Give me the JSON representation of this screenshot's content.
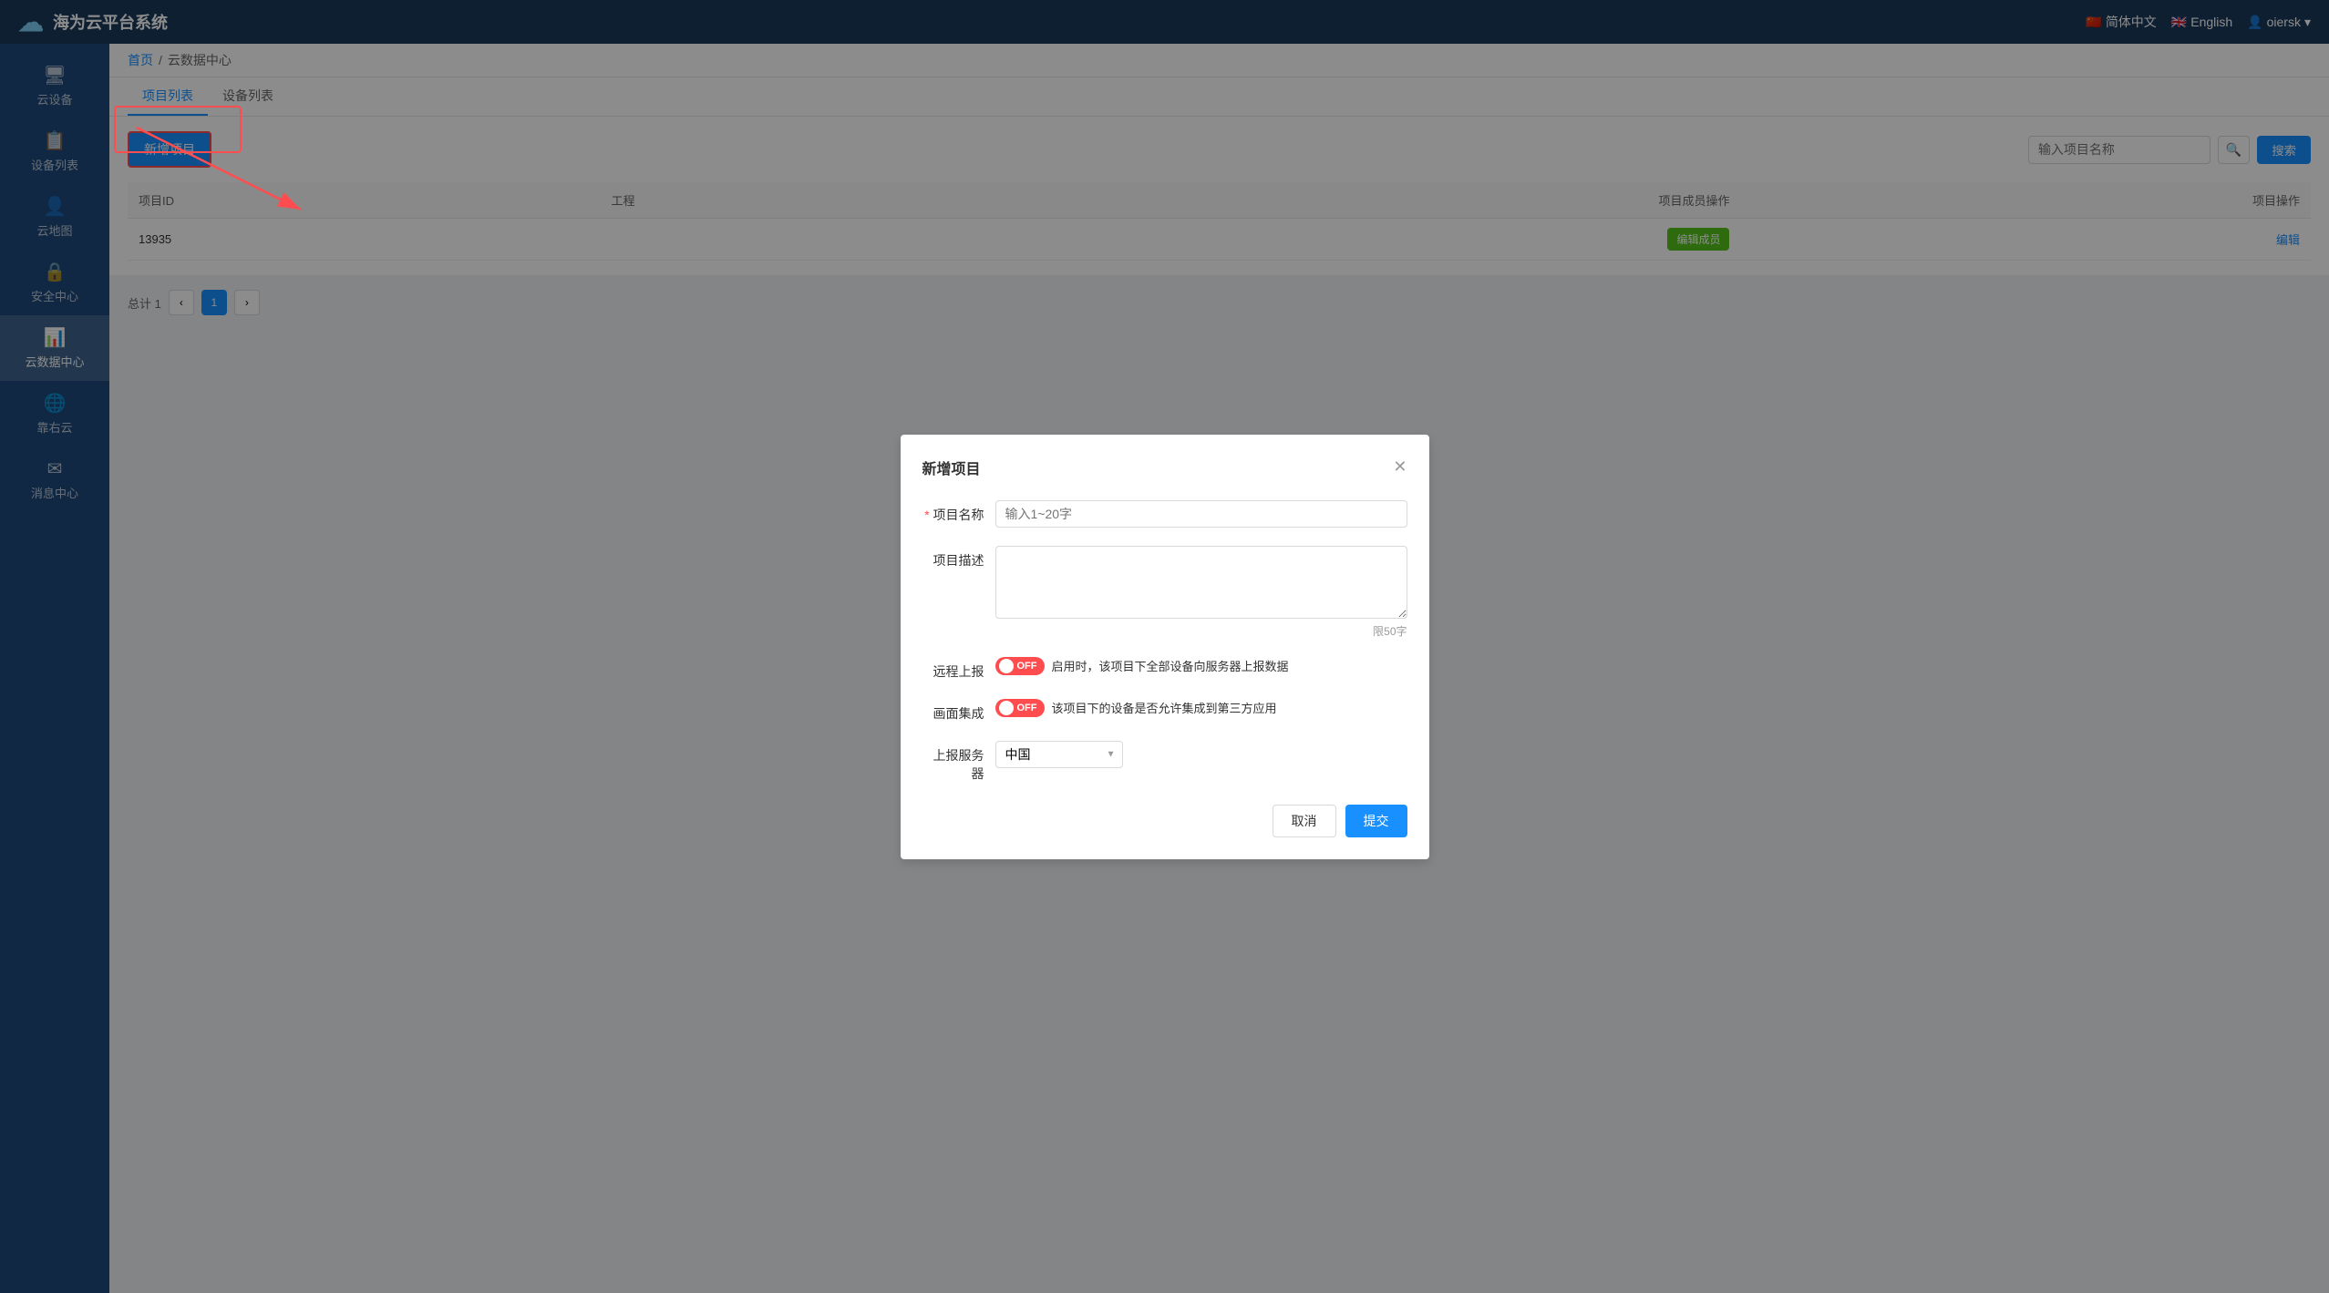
{
  "app": {
    "title": "海为云平台系统",
    "logo_text": "☁"
  },
  "header": {
    "lang_cn": "简体中文",
    "lang_en": "English",
    "user": "oiersk"
  },
  "sidebar": {
    "items": [
      {
        "id": "cloud-devices",
        "icon": "🖥",
        "label": "云设备"
      },
      {
        "id": "device-list",
        "icon": "📋",
        "label": "设备列表"
      },
      {
        "id": "cloud-map",
        "icon": "👤",
        "label": "云地图"
      },
      {
        "id": "security",
        "icon": "🔒",
        "label": "安全中心"
      },
      {
        "id": "cloud-data",
        "icon": "📊",
        "label": "云数据中心",
        "active": true
      },
      {
        "id": "stone-cloud",
        "icon": "🌐",
        "label": "靠右云"
      },
      {
        "id": "message",
        "icon": "✉",
        "label": "消息中心"
      }
    ]
  },
  "breadcrumb": {
    "home": "首页",
    "current": "云数据中心"
  },
  "tabs": [
    {
      "label": "项目列表",
      "active": true
    },
    {
      "label": "设备列表"
    }
  ],
  "toolbar": {
    "add_btn": "新增项目",
    "search_placeholder": "输入项目名称",
    "search_btn": "搜索"
  },
  "table": {
    "columns": [
      "项目ID",
      "工程",
      "项目成员操作",
      "项目操作"
    ],
    "rows": [
      {
        "id": "13935",
        "project": "",
        "member_op": "编辑成员",
        "op": "编辑"
      }
    ]
  },
  "footer": {
    "total_label": "总计 1",
    "page": "1"
  },
  "modal": {
    "title": "新增项目",
    "fields": {
      "name_label": "项目名称",
      "name_placeholder": "输入1~20字",
      "desc_label": "项目描述",
      "desc_placeholder": "",
      "desc_limit": "限50字",
      "remote_label": "远程上报",
      "remote_toggle": "OFF",
      "remote_desc": "启用时，该项目下全部设备向服务器上报数据",
      "screen_label": "画面集成",
      "screen_toggle": "OFF",
      "screen_desc": "该项目下的设备是否允许集成到第三方应用",
      "server_label": "上报服务器",
      "server_value": "中国"
    },
    "cancel_btn": "取消",
    "submit_btn": "提交"
  }
}
